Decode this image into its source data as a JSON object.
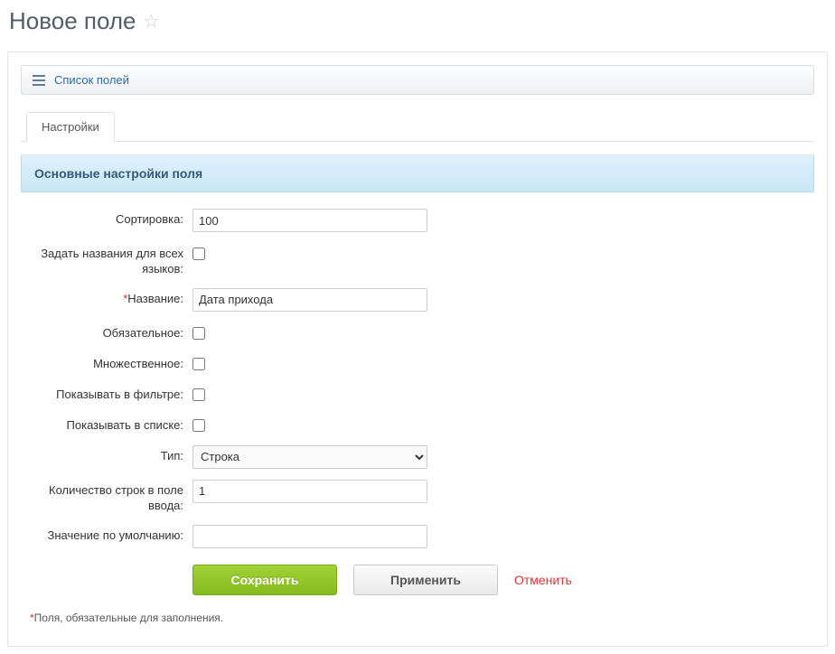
{
  "pageTitle": "Новое поле",
  "toolbar": {
    "listFieldsLabel": "Список полей"
  },
  "tabs": {
    "settings": "Настройки"
  },
  "sectionHeader": "Основные настройки поля",
  "labels": {
    "sort": "Сортировка:",
    "setAllLangNames": "Задать названия для всех языков:",
    "name": "Название:",
    "required": "Обязательное:",
    "multiple": "Множественное:",
    "showInFilter": "Показывать в фильтре:",
    "showInList": "Показывать в списке:",
    "type": "Тип:",
    "inputRows": "Количество строк в поле ввода:",
    "defaultValue": "Значение по умолчанию:"
  },
  "values": {
    "sort": "100",
    "name": "Дата прихода",
    "typeSelected": "Строка",
    "inputRows": "1",
    "defaultValue": ""
  },
  "buttons": {
    "save": "Сохранить",
    "apply": "Применить",
    "cancel": "Отменить"
  },
  "footnote": "Поля, обязательные для заполнения."
}
